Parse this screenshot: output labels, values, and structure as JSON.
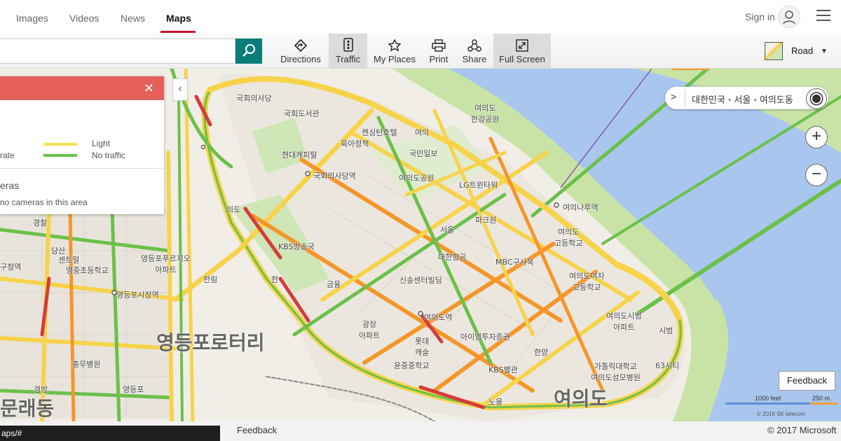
{
  "nav": {
    "tabs": [
      "Images",
      "Videos",
      "News",
      "Maps"
    ],
    "active": "Maps",
    "signin": "Sign in"
  },
  "toolbar": {
    "search": {
      "value": "",
      "placeholder": ""
    },
    "buttons": [
      {
        "label": "Directions",
        "icon": "directions-icon"
      },
      {
        "label": "Traffic",
        "icon": "traffic-icon",
        "active": true
      },
      {
        "label": "My Places",
        "icon": "star-icon"
      },
      {
        "label": "Print",
        "icon": "print-icon"
      },
      {
        "label": "Share",
        "icon": "share-icon"
      },
      {
        "label": "Full Screen",
        "icon": "fullscreen-icon",
        "active": true
      }
    ],
    "map_type": "Road"
  },
  "legend": {
    "items": [
      {
        "label": "rate",
        "color": "#f5962a"
      },
      {
        "label": "Light",
        "color": "#f7e04b"
      },
      {
        "label": "No traffic",
        "color": "#6cc04a"
      }
    ],
    "cameras_title": "eras",
    "cameras_text": "no cameras in this area",
    "header_color": "#e5605a"
  },
  "breadcrumb": {
    "parts": [
      "대한민국",
      "서울",
      "여의도동"
    ]
  },
  "map_labels": {
    "l01": "국회의사당",
    "l02": "국회도서관",
    "l03": "켄싱턴호텔",
    "l04": "여의",
    "l05": "여의도\n한강공원",
    "l06": "현대캐피탈",
    "l07": "육아정책",
    "l08": "국민일보",
    "l09": "국회의사당역",
    "l10": "여의도공원",
    "l11": "LG트윈타워",
    "l12": "여의나루역",
    "l13": "의도",
    "l14": "파크원",
    "l15": "서울",
    "l16": "KBS방송국",
    "l17": "대한항공",
    "l18": "MBC구사옥",
    "l19": "여의도\n고등학교",
    "l20": "경찰",
    "l21": "당산",
    "l22": "센트럴",
    "l23": "구청역",
    "l24": "영중초등학교",
    "l25": "영등포푸르지오\n아파트",
    "l26": "영등포시장역",
    "l27": "한림",
    "l28": "신송센터빌딩",
    "l29": "여의도여자\n고등학교",
    "l30": "여의도역",
    "l31": "광장\n아파트",
    "l32": "아이엠투자증권",
    "l33": "여의도시범\n아파트",
    "l34": "롯데\n캐슬",
    "l35": "윤중중학교",
    "l36": "KBS별관",
    "l37": "가톨릭대학교\n여의도성모병원",
    "l38": "63시티",
    "l39": "충무병원",
    "l40": "영등포로터리",
    "l41": "문래동",
    "l42": "여의도",
    "l43": "노을",
    "l44": "경방",
    "l45": "영등포",
    "l46": "금융",
    "l47": "한",
    "l48": "시범",
    "l49": "한양"
  },
  "map": {
    "feedback": "Feedback",
    "scale": [
      "1000 feet",
      "250 m"
    ],
    "copyright": "© 2016 SK telecom"
  },
  "footer": {
    "status_url": "aps/#",
    "feedback": "Feedback",
    "copyright": "© 2017 Microsoft"
  }
}
